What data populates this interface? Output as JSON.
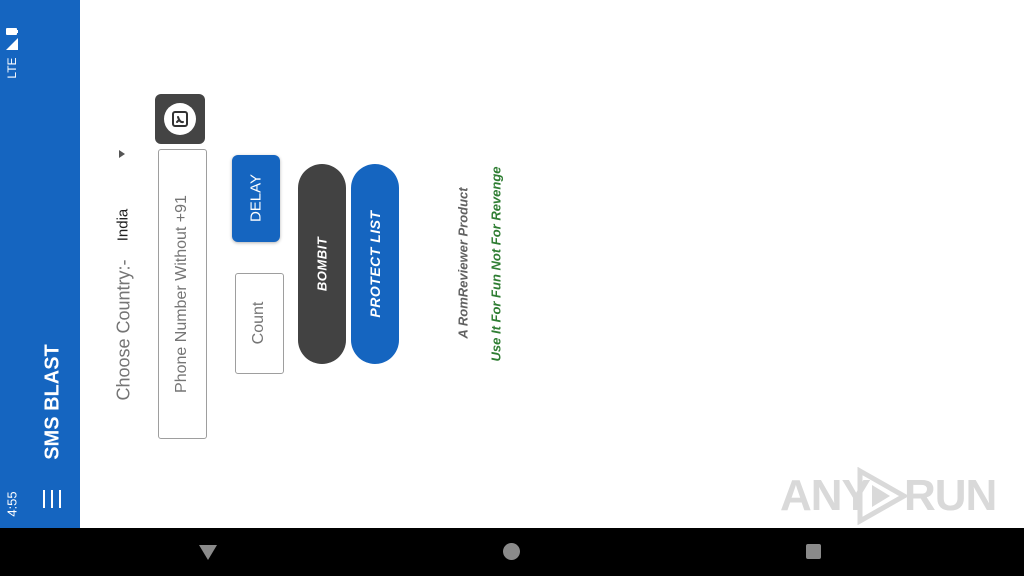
{
  "status_bar": {
    "time": "4:55",
    "network": "LTE"
  },
  "app_bar": {
    "title": "SMS BLAST",
    "menu_icon": "hamburger-menu-icon"
  },
  "form": {
    "country_label": "Choose Country:-",
    "country_value": "India",
    "phone_placeholder": "Phone Number Without +91",
    "count_placeholder": "Count",
    "delay_label": "DELAY",
    "contact_icon": "contact-book-icon"
  },
  "actions": {
    "bombit_label": "BOMBIT",
    "protect_label": "PROTECT LIST"
  },
  "credits": {
    "product": "A RomReviewer Product",
    "tagline": "Use It For Fun Not For Revenge"
  },
  "watermark": {
    "text_left": "ANY",
    "text_right": "RUN"
  },
  "colors": {
    "primary": "#1565c0",
    "dark_button": "#424242",
    "tagline_green": "#2e7d32",
    "credit_gray": "#616161"
  }
}
